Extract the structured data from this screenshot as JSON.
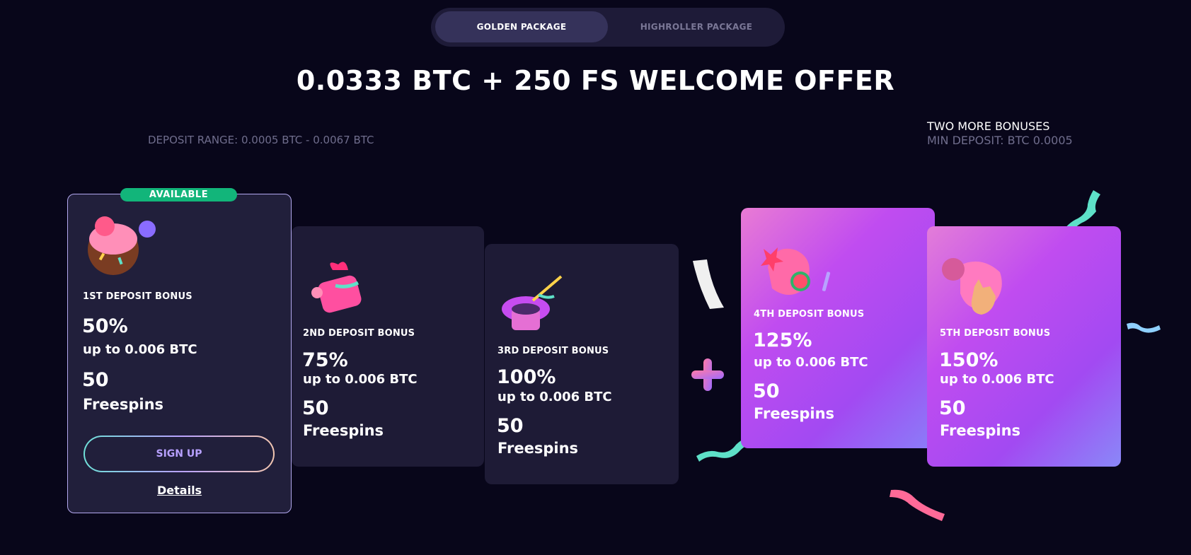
{
  "tabs": [
    {
      "label": "GOLDEN PACKAGE",
      "active": true
    },
    {
      "label": "HIGHROLLER PACKAGE",
      "active": false
    }
  ],
  "offer_title": "0.0333 BTC + 250 FS WELCOME OFFER",
  "deposit_range": "DEPOSIT RANGE: 0.0005 BTC - 0.0067 BTC",
  "more_bonuses": {
    "title": "TWO MORE BONUSES",
    "min_deposit": "MIN DEPOSIT: BTC 0.0005"
  },
  "cards": [
    {
      "badge": "AVAILABLE",
      "label": "1ST DEPOSIT BONUS",
      "percent": "50%",
      "up_to": "up to 0.006 BTC",
      "freespins_count": "50",
      "freespins_label": "Freespins",
      "icon": "cake-icon"
    },
    {
      "label": "2ND DEPOSIT BONUS",
      "percent": "75%",
      "up_to": "up to 0.006 BTC",
      "freespins_count": "50",
      "freespins_label": "Freespins",
      "icon": "gift-icon"
    },
    {
      "label": "3RD DEPOSIT BONUS",
      "percent": "100%",
      "up_to": "up to 0.006 BTC",
      "freespins_count": "50",
      "freespins_label": "Freespins",
      "icon": "magic-hat-icon"
    },
    {
      "label": "4TH DEPOSIT BONUS",
      "percent": "125%",
      "up_to": "up to 0.006 BTC",
      "freespins_count": "50",
      "freespins_label": "Freespins",
      "icon": "candy-icon"
    },
    {
      "label": "5TH DEPOSIT BONUS",
      "percent": "150%",
      "up_to": "up to 0.006 BTC",
      "freespins_count": "50",
      "freespins_label": "Freespins",
      "icon": "hand-icon"
    }
  ],
  "signup_label": "SIGN UP",
  "details_label": "Details",
  "colors": {
    "background": "#08061a",
    "badge": "#12b57a",
    "accent_purple": "#b7a0ff"
  }
}
